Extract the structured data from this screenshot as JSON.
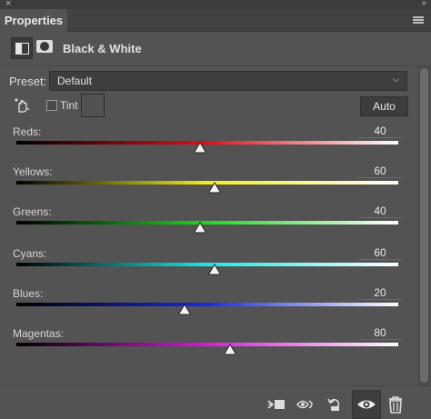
{
  "panel": {
    "close_glyph": "×",
    "collapse_glyph": "»",
    "tab_title": "Properties",
    "menu_icon": "panel-menu-icon"
  },
  "header": {
    "adjustment_icon": "black-white-adjustment-icon",
    "mask_icon": "layer-mask-icon",
    "title": "Black & White"
  },
  "preset": {
    "label": "Preset:",
    "value": "Default"
  },
  "tint": {
    "label": "Tint",
    "checked": false,
    "swatch_color": "#525252"
  },
  "auto_button": "Auto",
  "sliders": [
    {
      "label": "Reds:",
      "value": "40",
      "gradient_end": "#e0101a"
    },
    {
      "label": "Yellows:",
      "value": "60",
      "gradient_end": "#f3ef1a"
    },
    {
      "label": "Greens:",
      "value": "40",
      "gradient_end": "#20d620"
    },
    {
      "label": "Cyans:",
      "value": "60",
      "gradient_end": "#1ae8e8"
    },
    {
      "label": "Blues:",
      "value": "20",
      "gradient_end": "#1a2ae0"
    },
    {
      "label": "Magentas:",
      "value": "80",
      "gradient_end": "#d81ad8"
    }
  ],
  "slider_range": {
    "min": -200,
    "max": 300
  },
  "bottom_bar": {
    "icons": [
      "clip-to-layer-icon",
      "view-previous-state-icon",
      "reset-icon",
      "toggle-visibility-icon",
      "delete-icon"
    ]
  }
}
